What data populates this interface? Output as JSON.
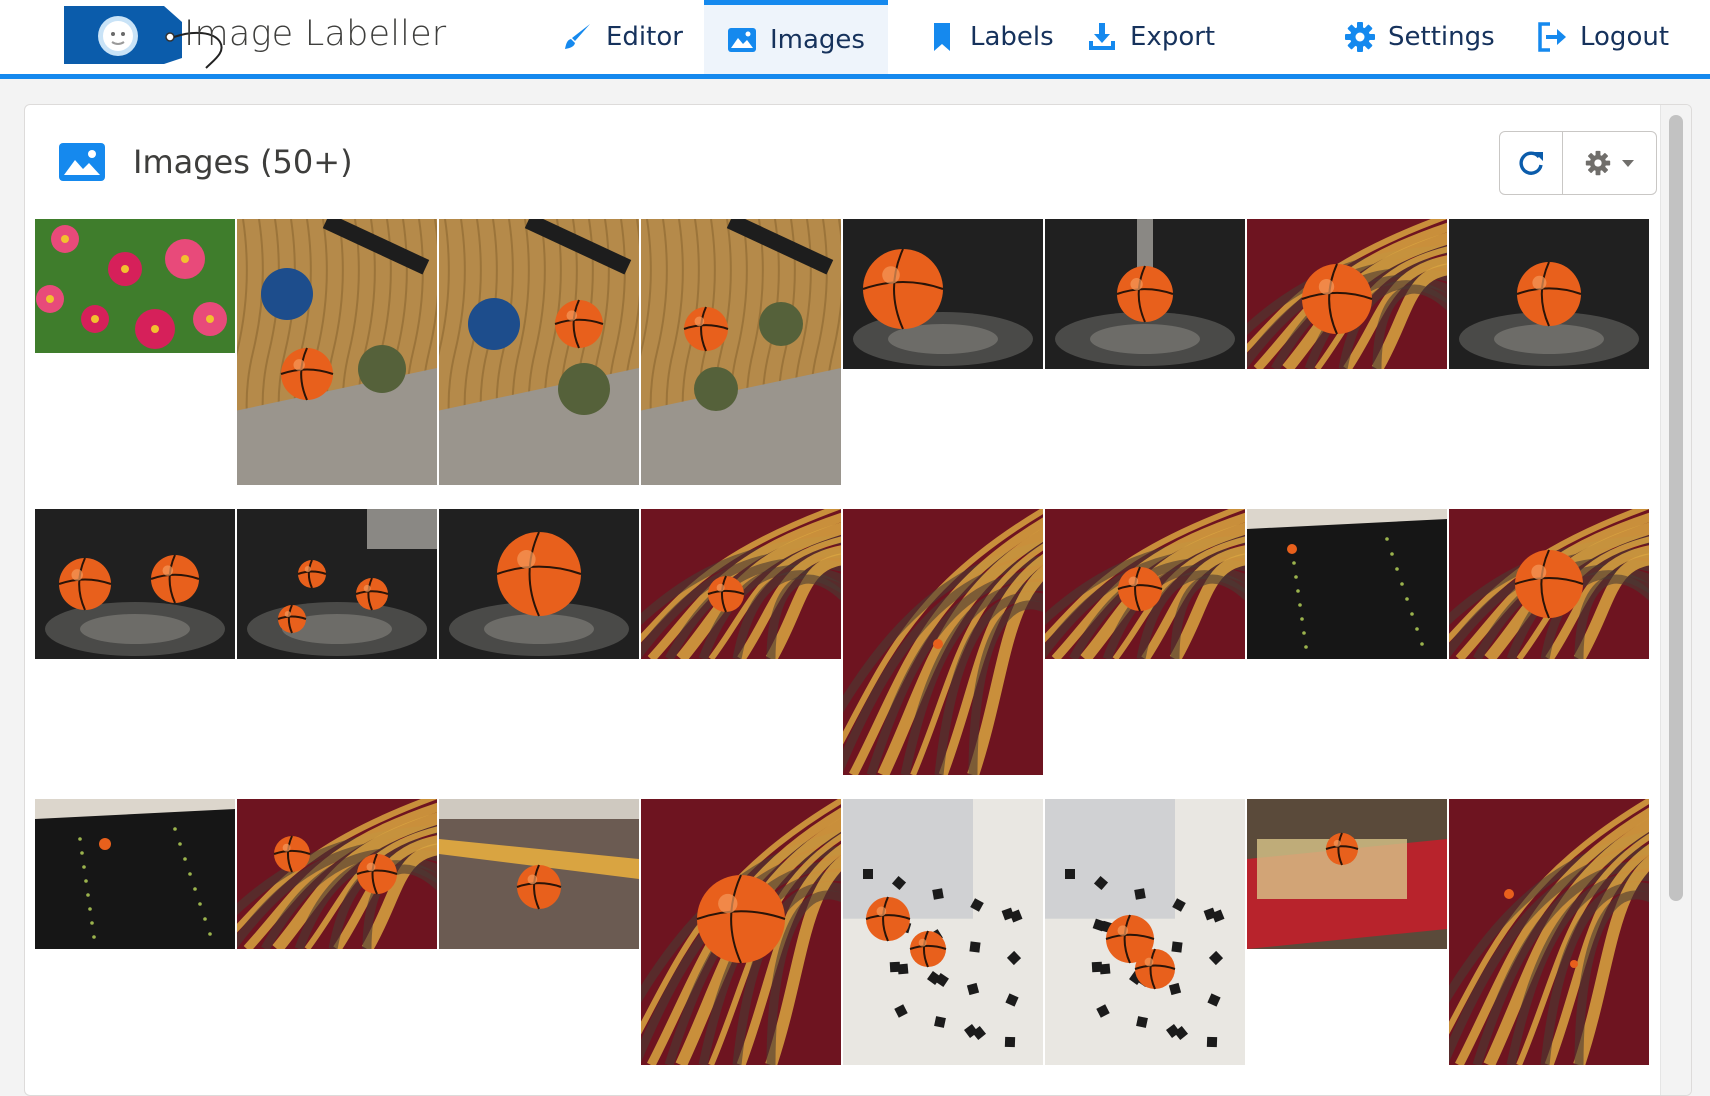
{
  "app": {
    "title": "Image Labeller",
    "logo_icon": "price-tag-logo-icon"
  },
  "nav": {
    "items": [
      {
        "label": "Editor",
        "icon": "brush-icon",
        "active": false
      },
      {
        "label": "Images",
        "icon": "image-icon",
        "active": true
      },
      {
        "label": "Labels",
        "icon": "bookmark-icon",
        "active": false
      },
      {
        "label": "Export",
        "icon": "download-icon",
        "active": false
      }
    ],
    "right_items": [
      {
        "label": "Settings",
        "icon": "gear-icon"
      },
      {
        "label": "Logout",
        "icon": "logout-icon"
      }
    ]
  },
  "images_panel": {
    "title": "Images (50+)",
    "header_icon": "image-icon",
    "refresh_icon": "refresh-icon",
    "settings_icon": "gear-icon",
    "dropdown_icon": "caret-down-icon"
  },
  "images": [
    {
      "subject": "flowers"
    },
    {
      "subject": "balls on table"
    },
    {
      "subject": "balls on table"
    },
    {
      "subject": "balls on table"
    },
    {
      "subject": "basketball stand"
    },
    {
      "subject": "basketball stand"
    },
    {
      "subject": "basketball carpet"
    },
    {
      "subject": "basketball stand"
    },
    {
      "subject": "two basketballs"
    },
    {
      "subject": "basketballs near phone"
    },
    {
      "subject": "basketball close up"
    },
    {
      "subject": "basketball carpet"
    },
    {
      "subject": "carpet pattern"
    },
    {
      "subject": "basketball carpet"
    },
    {
      "subject": "dark board"
    },
    {
      "subject": "basketball carpet"
    },
    {
      "subject": "dark board"
    },
    {
      "subject": "basketballs carpet"
    },
    {
      "subject": "basketball hallway"
    },
    {
      "subject": "basketball carpet close"
    },
    {
      "subject": "parts on desk"
    },
    {
      "subject": "parts on desk"
    },
    {
      "subject": "box of parts"
    },
    {
      "subject": "carpet pattern"
    }
  ],
  "colors": {
    "accent": "#1589ee",
    "nav_text": "#16325c",
    "basketball": "#e8601c"
  }
}
